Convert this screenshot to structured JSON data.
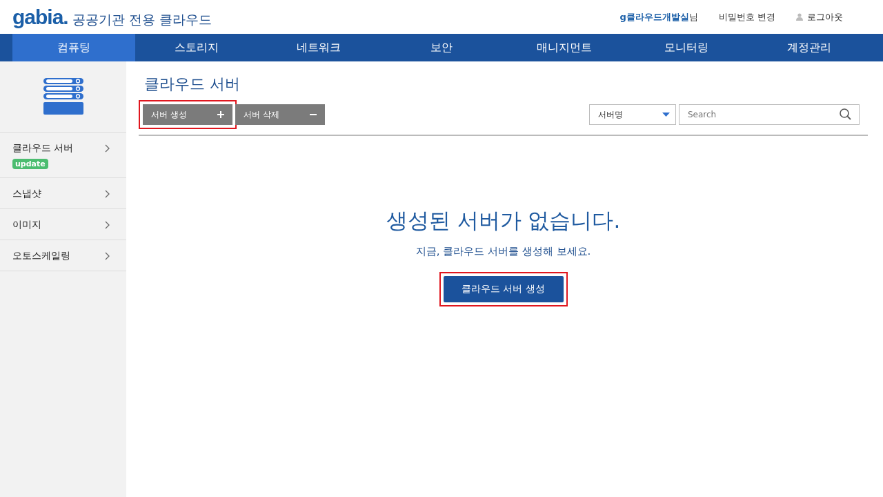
{
  "header": {
    "logo": "gabia.",
    "subtitle": "공공기관 전용 클라우드",
    "user": {
      "name": "g클라우드개발실",
      "suffix": "님"
    },
    "links": [
      {
        "kind": "text",
        "label": "비밀번호 변경"
      },
      {
        "kind": "user",
        "label": "로그아웃"
      }
    ]
  },
  "nav": [
    {
      "label": "컴퓨팅",
      "selected": true
    },
    {
      "label": "스토리지",
      "selected": false
    },
    {
      "label": "네트워크",
      "selected": false
    },
    {
      "label": "보안",
      "selected": false
    },
    {
      "label": "매니지먼트",
      "selected": false
    },
    {
      "label": "모니터링",
      "selected": false
    },
    {
      "label": "계정관리",
      "selected": false
    }
  ],
  "sidebar": {
    "items": [
      {
        "label": "클라우드 서버",
        "badge": "update"
      },
      {
        "label": "스냅샷"
      },
      {
        "label": "이미지"
      },
      {
        "label": "오토스케일링"
      }
    ]
  },
  "page": {
    "title": "클라우드 서버",
    "actions": [
      {
        "label": "서버 생성",
        "kind": "add",
        "highlighted": true
      },
      {
        "label": "서버 삭제",
        "kind": "remove",
        "highlighted": false
      }
    ],
    "filter": {
      "value": "서버명"
    },
    "search": {
      "placeholder": "Search"
    }
  },
  "empty": {
    "heading": "생성된 서버가 없습니다.",
    "message": "지금, 클라우드 서버를 생성해 보세요.",
    "button": {
      "label": "클라우드 서버 생성",
      "highlighted": true
    }
  }
}
